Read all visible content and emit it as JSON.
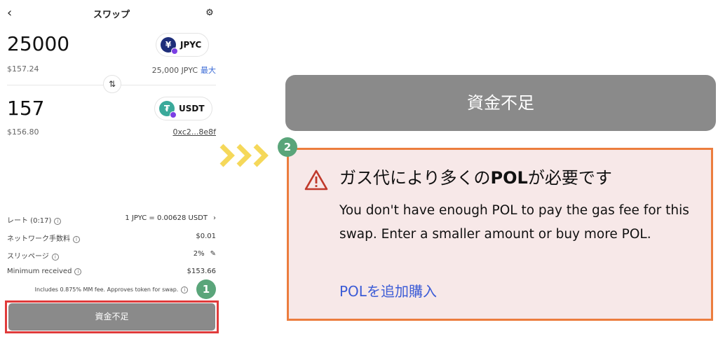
{
  "phone": {
    "title": "スワップ",
    "from": {
      "amount": "25000",
      "fiat": "$157.24",
      "token": "JPYC",
      "balance": "25,000 JPYC",
      "max_label": "最大"
    },
    "to": {
      "amount": "157",
      "fiat": "$156.80",
      "token": "USDT",
      "address": "0xc2...8e8f"
    },
    "rows": [
      {
        "label": "レート (0:17)",
        "value": "1 JPYC = 0.00628 USDT"
      },
      {
        "label": "ネットワーク手数料",
        "value": "$0.01"
      },
      {
        "label": "スリッページ",
        "value": "2%"
      },
      {
        "label": "Minimum received",
        "value": "$153.66"
      }
    ],
    "fee_note": "Includes 0.875% MM fee. Approves token for swap.",
    "button_label": "資金不足"
  },
  "badges": {
    "one": "1",
    "two": "2"
  },
  "zoom": {
    "button_label": "資金不足",
    "warning": {
      "title_pre": "ガス代により多くの",
      "title_bold": "POL",
      "title_post": "が必要です",
      "body": "You don't have enough POL to pay the gas fee for this swap. Enter a smaller amount or buy more POL.",
      "link": "POLを追加購入"
    }
  },
  "colors": {
    "badge_green": "#5aa57a",
    "highlight_red": "#e03b3b",
    "warning_orange": "#ec7d3e",
    "warning_bg": "#f7e8e8",
    "chevron_yellow": "#f5d85a",
    "link_blue": "#3b5bd6",
    "button_gray": "#8a8a8a"
  }
}
